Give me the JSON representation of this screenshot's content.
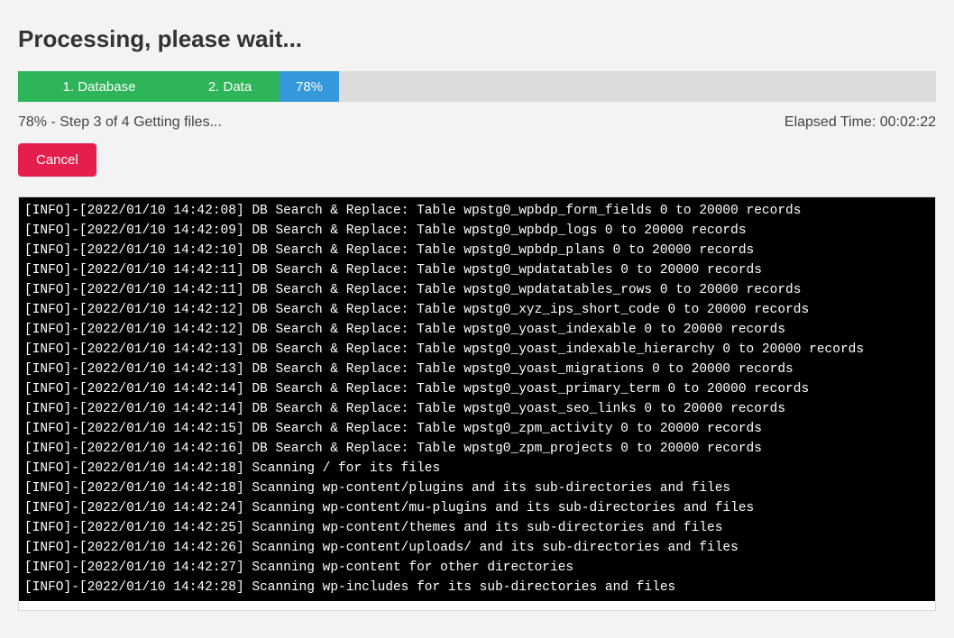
{
  "header": {
    "title": "Processing, please wait..."
  },
  "progress": {
    "step1_label": "1. Database",
    "step2_label": "2. Data",
    "percent_label": "78%"
  },
  "status": {
    "step_text": "78% - Step 3 of 4 Getting files...",
    "elapsed_text": "Elapsed Time: 00:02:22"
  },
  "buttons": {
    "cancel": "Cancel"
  },
  "log_lines": [
    "[INFO]-[2022/01/10 14:42:08] DB Search & Replace: Table wpstg0_wpbdp_form_fields 0 to 20000 records",
    "[INFO]-[2022/01/10 14:42:09] DB Search & Replace: Table wpstg0_wpbdp_logs 0 to 20000 records",
    "[INFO]-[2022/01/10 14:42:10] DB Search & Replace: Table wpstg0_wpbdp_plans 0 to 20000 records",
    "[INFO]-[2022/01/10 14:42:11] DB Search & Replace: Table wpstg0_wpdatatables 0 to 20000 records",
    "[INFO]-[2022/01/10 14:42:11] DB Search & Replace: Table wpstg0_wpdatatables_rows 0 to 20000 records",
    "[INFO]-[2022/01/10 14:42:12] DB Search & Replace: Table wpstg0_xyz_ips_short_code 0 to 20000 records",
    "[INFO]-[2022/01/10 14:42:12] DB Search & Replace: Table wpstg0_yoast_indexable 0 to 20000 records",
    "[INFO]-[2022/01/10 14:42:13] DB Search & Replace: Table wpstg0_yoast_indexable_hierarchy 0 to 20000 records",
    "[INFO]-[2022/01/10 14:42:13] DB Search & Replace: Table wpstg0_yoast_migrations 0 to 20000 records",
    "[INFO]-[2022/01/10 14:42:14] DB Search & Replace: Table wpstg0_yoast_primary_term 0 to 20000 records",
    "[INFO]-[2022/01/10 14:42:14] DB Search & Replace: Table wpstg0_yoast_seo_links 0 to 20000 records",
    "[INFO]-[2022/01/10 14:42:15] DB Search & Replace: Table wpstg0_zpm_activity 0 to 20000 records",
    "[INFO]-[2022/01/10 14:42:16] DB Search & Replace: Table wpstg0_zpm_projects 0 to 20000 records",
    "[INFO]-[2022/01/10 14:42:18] Scanning / for its files",
    "[INFO]-[2022/01/10 14:42:18] Scanning wp-content/plugins and its sub-directories and files",
    "[INFO]-[2022/01/10 14:42:24] Scanning wp-content/mu-plugins and its sub-directories and files",
    "[INFO]-[2022/01/10 14:42:25] Scanning wp-content/themes and its sub-directories and files",
    "[INFO]-[2022/01/10 14:42:26] Scanning wp-content/uploads/ and its sub-directories and files",
    "[INFO]-[2022/01/10 14:42:27] Scanning wp-content for other directories",
    "[INFO]-[2022/01/10 14:42:28] Scanning wp-includes for its sub-directories and files"
  ]
}
